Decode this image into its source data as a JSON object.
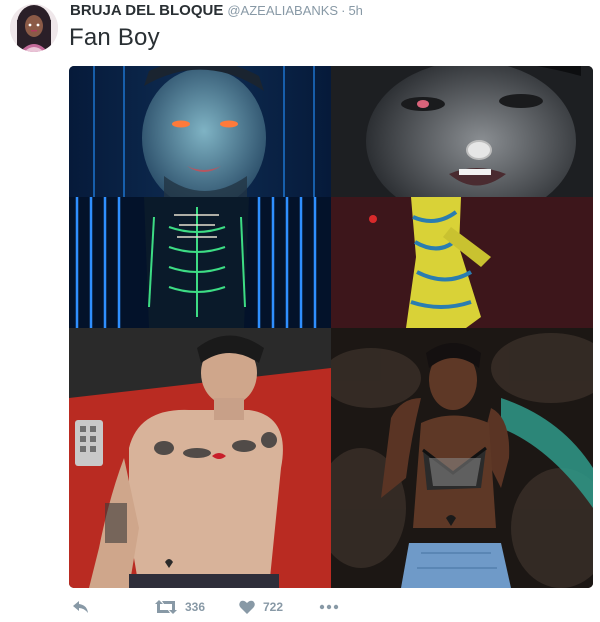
{
  "tweet": {
    "display_name": "BRUJA DEL BLOQUE",
    "handle": "@AZEALIABANKS",
    "separator": "·",
    "timestamp": "5h",
    "text": "Fan Boy"
  },
  "media": {
    "tiles": [
      {
        "name": "face-portrait-blue-light",
        "alt": ""
      },
      {
        "name": "face-portrait-monochrome",
        "alt": ""
      },
      {
        "name": "neon-suit-blue-stripes",
        "alt": ""
      },
      {
        "name": "yellow-bodysuit-performer",
        "alt": ""
      },
      {
        "name": "shirtless-tattooed-man",
        "alt": ""
      },
      {
        "name": "woman-lying-on-fur",
        "alt": ""
      }
    ]
  },
  "actions": {
    "reply_icon": "reply-icon",
    "retweet_icon": "retweet-icon",
    "retweet_count": "336",
    "like_icon": "heart-icon",
    "like_count": "722",
    "more_icon": "more-icon"
  },
  "colors": {
    "text": "#292f33",
    "muted": "#8899a6"
  }
}
